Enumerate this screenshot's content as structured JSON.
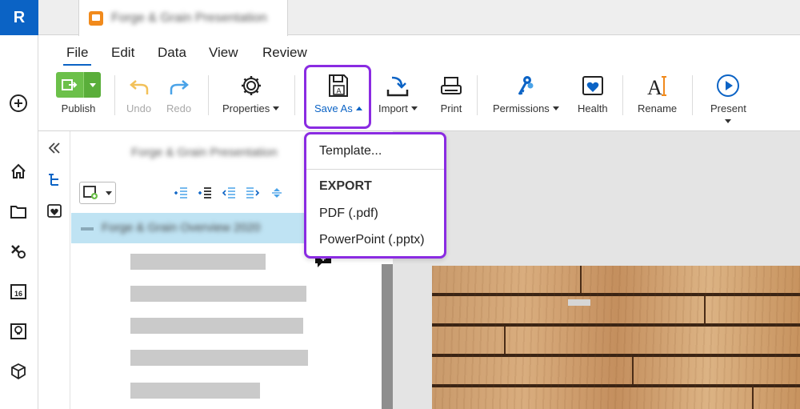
{
  "rail": {
    "logo": "R",
    "items": [
      "add-icon",
      "home-icon",
      "folder-icon",
      "shapes-icon",
      "calendar-icon",
      "lightbulb-icon",
      "cube-icon"
    ]
  },
  "tab": {
    "title": "Forge & Grain Presentation"
  },
  "menus": [
    "File",
    "Edit",
    "Data",
    "View",
    "Review"
  ],
  "ribbon": {
    "publish": "Publish",
    "undo": "Undo",
    "redo": "Redo",
    "properties": "Properties",
    "save_as": "Save As",
    "import": "Import",
    "print": "Print",
    "permissions": "Permissions",
    "health": "Health",
    "rename": "Rename",
    "present": "Present"
  },
  "save_as_menu": {
    "template": "Template...",
    "export_header": "EXPORT",
    "pdf": "PDF (.pdf)",
    "pptx": "PowerPoint (.pptx)"
  },
  "outline": {
    "title": "Forge & Grain Presentation",
    "selected_row": "Forge & Grain Overview 2020"
  },
  "colors": {
    "accent": "#0b63c5",
    "highlight": "#8a2be2",
    "publish_green": "#6cc04a",
    "selection": "#bfe3f3"
  }
}
